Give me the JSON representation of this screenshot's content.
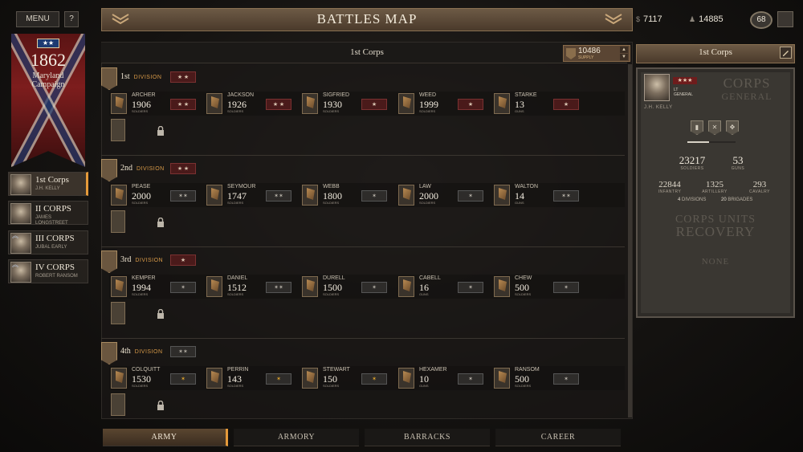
{
  "sidebar": {
    "menu_label": "MENU",
    "help_label": "?",
    "flag_stars": "★★",
    "year": "1862",
    "campaign": "Maryland\nCampaign",
    "corps": [
      {
        "name": "1st Corps",
        "general": "J.H. KELLY",
        "active": true
      },
      {
        "name": "II CORPS",
        "general": "JAMES\nLONGSTREET",
        "active": false
      },
      {
        "name": "III CORPS",
        "general": "JUBAL EARLY",
        "active": false
      },
      {
        "name": "IV CORPS",
        "general": "ROBERT RANSOM",
        "active": false
      }
    ]
  },
  "header": {
    "title": "BATTLES MAP"
  },
  "resources": {
    "money_symbol": "$",
    "money": "7117",
    "recruits_symbol": "♟",
    "recruits": "14885",
    "level": "68"
  },
  "corps_panel": {
    "title": "1st Corps",
    "supply_value": "10486",
    "supply_label": "SUPPLY"
  },
  "divisions": [
    {
      "name": "1st",
      "word": "DIVISION",
      "badge": "★ ★",
      "badge_style": "red",
      "brigades": [
        {
          "name": "ARCHER",
          "value": "1906",
          "unit": "SOLDIERS",
          "badge": "★ ★",
          "style": "red"
        },
        {
          "name": "JACKSON",
          "value": "1926",
          "unit": "SOLDIERS",
          "badge": "★ ★",
          "style": "red"
        },
        {
          "name": "SIGFRIED",
          "value": "1930",
          "unit": "SOLDIERS",
          "badge": "★",
          "style": "red"
        },
        {
          "name": "WEED",
          "value": "1999",
          "unit": "SOLDIERS",
          "badge": "★",
          "style": "red"
        },
        {
          "name": "STARKE",
          "value": "13",
          "unit": "GUNS",
          "badge": "★",
          "style": "red"
        }
      ]
    },
    {
      "name": "2nd",
      "word": "DIVISION",
      "badge": "★ ★",
      "badge_style": "red",
      "brigades": [
        {
          "name": "PEASE",
          "value": "2000",
          "unit": "SOLDIERS",
          "badge": "✶✶",
          "style": "grey"
        },
        {
          "name": "SEYMOUR",
          "value": "1747",
          "unit": "SOLDIERS",
          "badge": "✶✶",
          "style": "grey"
        },
        {
          "name": "WEBB",
          "value": "1800",
          "unit": "SOLDIERS",
          "badge": "✶",
          "style": "grey"
        },
        {
          "name": "LAW",
          "value": "2000",
          "unit": "SOLDIERS",
          "badge": "✶",
          "style": "grey"
        },
        {
          "name": "WALTON",
          "value": "14",
          "unit": "GUNS",
          "badge": "✶✶",
          "style": "grey"
        }
      ]
    },
    {
      "name": "3rd",
      "word": "DIVISION",
      "badge": "★",
      "badge_style": "red",
      "brigades": [
        {
          "name": "KEMPER",
          "value": "1994",
          "unit": "SOLDIERS",
          "badge": "✶",
          "style": "grey"
        },
        {
          "name": "DANIEL",
          "value": "1512",
          "unit": "SOLDIERS",
          "badge": "✶✶",
          "style": "grey"
        },
        {
          "name": "DURELL",
          "value": "1500",
          "unit": "SOLDIERS",
          "badge": "✶",
          "style": "grey"
        },
        {
          "name": "CABELL",
          "value": "16",
          "unit": "GUNS",
          "badge": "✶",
          "style": "grey"
        },
        {
          "name": "CHEW",
          "value": "500",
          "unit": "SOLDIERS",
          "badge": "✶",
          "style": "grey"
        }
      ]
    },
    {
      "name": "4th",
      "word": "DIVISION",
      "badge": "✶✶",
      "badge_style": "grey",
      "brigades": [
        {
          "name": "COLQUITT",
          "value": "1530",
          "unit": "SOLDIERS",
          "badge": "✶",
          "style": "gold"
        },
        {
          "name": "PERRIN",
          "value": "143",
          "unit": "SOLDIERS",
          "badge": "✶",
          "style": "gold"
        },
        {
          "name": "STEWART",
          "value": "150",
          "unit": "SOLDIERS",
          "badge": "✶",
          "style": "gold"
        },
        {
          "name": "HEXAMER",
          "value": "10",
          "unit": "GUNS",
          "badge": "✶",
          "style": "grey"
        },
        {
          "name": "RANSOM",
          "value": "500",
          "unit": "SOLDIERS",
          "badge": "✶",
          "style": "grey"
        }
      ]
    }
  ],
  "tabs": [
    {
      "label": "ARMY",
      "active": true
    },
    {
      "label": "ARMORY",
      "active": false
    },
    {
      "label": "BARRACKS",
      "active": false
    },
    {
      "label": "CAREER",
      "active": false
    }
  ],
  "right_panel": {
    "title": "1st Corps",
    "general_stars": "★★★",
    "general_rank": "LT\nGENERAL",
    "general_name": "J.H. KELLY",
    "corps_word": "CORPS",
    "general_word": "GENERAL",
    "skills": [
      "▮",
      "✕",
      "✥"
    ],
    "xp_fraction": 0.45,
    "soldiers": "23217",
    "soldiers_label": "SOLDIERS",
    "guns": "53",
    "guns_label": "GUNS",
    "infantry": "22844",
    "infantry_label": "INFANTRY",
    "artillery": "1325",
    "artillery_label": "ARTILLERY",
    "cavalry": "293",
    "cavalry_label": "CAVALRY",
    "divisions_count": "4",
    "divisions_label": "DIVISIONS",
    "brigades_count": "20",
    "brigades_label": "BRIGADES",
    "units_title1": "CORPS UNITS",
    "units_title2": "RECOVERY",
    "units_none": "NONE"
  },
  "colors": {
    "accent": "#e59a3a",
    "header": "#5b4a38",
    "red_badge": "#4a1a1a",
    "gold": "#e1a52d"
  }
}
